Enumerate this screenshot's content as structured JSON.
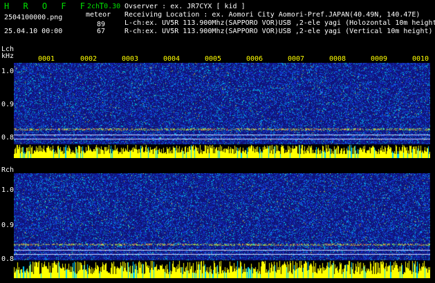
{
  "header": {
    "app_title": "H R O F F T",
    "version": "2ch 0.30",
    "meteor_label": "meteor",
    "filename": "2504100000.png",
    "datetime": "25.04.10 00:00",
    "meteor_count_l": "89",
    "meteor_count_r": "67",
    "observer": "Ovserver           : ex. JR7CYX [ kid ]",
    "location": "Receiving Location : ex. Aomori City Aomori-Pref.JAPAN(40.49N, 140.47E)",
    "lch_info": "L-ch:ex. UV5R 113.900Mhz(SAPPORO VOR)USB ,2-ele yagi (Holozontal 10m height)",
    "rch_info": "R-ch:ex. UV5R 113.900Mhz(SAPPORO VOR)USB ,2-ele yagi (Vertical 10m height)"
  },
  "lch_panel": {
    "channel_label": "Lch",
    "unit_label": "kHz",
    "y_ticks": [
      "1.0",
      "0.9",
      "0.8"
    ]
  },
  "rch_panel": {
    "channel_label": "Rch",
    "y_ticks": [
      "1.0",
      "0.9",
      "0.8"
    ]
  },
  "time_ticks": [
    "0001",
    "0002",
    "0003",
    "0004",
    "0005",
    "0006",
    "0007",
    "0008",
    "0009",
    "0010"
  ],
  "colors": {
    "background": "#000000",
    "spectrum_bg": "#10147a",
    "signal_yellow": "#ffff00",
    "signal_cyan": "#00d0ff",
    "text_green": "#00e000",
    "text_yellow": "#ffff00"
  }
}
